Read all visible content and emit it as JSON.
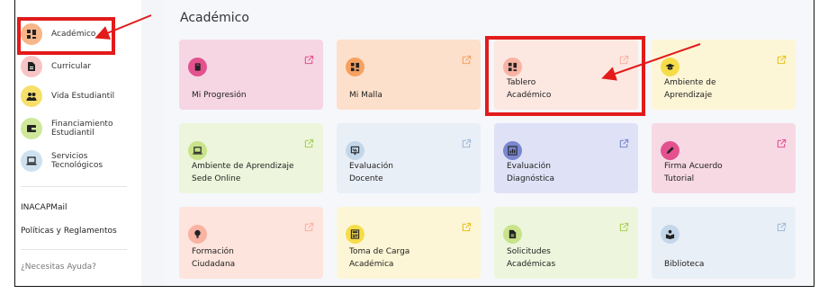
{
  "sidebar": {
    "items": [
      {
        "label": "Académico",
        "icon": "grid-icon",
        "color": "#f7b58a"
      },
      {
        "label": "Curricular",
        "icon": "document-icon",
        "color": "#f7c4c4"
      },
      {
        "label": "Vida Estudiantil",
        "icon": "group-icon",
        "color": "#f6e06b"
      },
      {
        "label": "Financiamiento Estudiantil",
        "icon": "wallet-icon",
        "color": "#cfe79a"
      },
      {
        "label": "Servicios Tecnológicos",
        "icon": "laptop-icon",
        "color": "#cfe0ef"
      }
    ],
    "links": [
      "INACAPMail",
      "Políticas y Reglamentos"
    ],
    "help": "¿Necesitas Ayuda?"
  },
  "main": {
    "title": "Académico",
    "cards": [
      {
        "label": "Mi Progresión",
        "icon": "book-icon",
        "bg": "#f6d6e3",
        "icon_bg": "#e3528f"
      },
      {
        "label": "Mi Malla",
        "icon": "grid-icon",
        "bg": "#fde0cb",
        "icon_bg": "#f6a15f"
      },
      {
        "label": "Tablero Académico",
        "icon": "grid-icon",
        "bg": "#fde7e1",
        "icon_bg": "#f9b3a3"
      },
      {
        "label": "Ambiente de Aprendizaje",
        "icon": "graduation-cap-icon",
        "bg": "#fdf6d6",
        "icon_bg": "#f7dc4a"
      },
      {
        "label": "Ambiente de Aprendizaje Sede Online",
        "icon": "laptop-icon",
        "bg": "#edf6dc",
        "icon_bg": "#c8e38a"
      },
      {
        "label": "Evaluación Docente",
        "icon": "presentation-icon",
        "bg": "#e9eff7",
        "icon_bg": "#c4d7ea"
      },
      {
        "label": "Evaluación Diagnóstica",
        "icon": "chart-icon",
        "bg": "#dfe2f6",
        "icon_bg": "#7a86cf"
      },
      {
        "label": "Firma Acuerdo Tutorial",
        "icon": "pen-icon",
        "bg": "#f7d9e4",
        "icon_bg": "#e3528f"
      },
      {
        "label": "Formación Ciudadana",
        "icon": "lightbulb-icon",
        "bg": "#fde4dc",
        "icon_bg": "#f9b3a3"
      },
      {
        "label": "Toma de Carga Académica",
        "icon": "calculator-icon",
        "bg": "#fdf6d6",
        "icon_bg": "#f7dc4a"
      },
      {
        "label": "Solicitudes Académicas",
        "icon": "document-icon",
        "bg": "#edf6dc",
        "icon_bg": "#c8e38a"
      },
      {
        "label": "Biblioteca",
        "icon": "reader-icon",
        "bg": "#e9eff7",
        "icon_bg": "#c4d7ea"
      }
    ]
  },
  "colors": {
    "highlight": "#e21b1b",
    "external_link": "#e3528f"
  }
}
